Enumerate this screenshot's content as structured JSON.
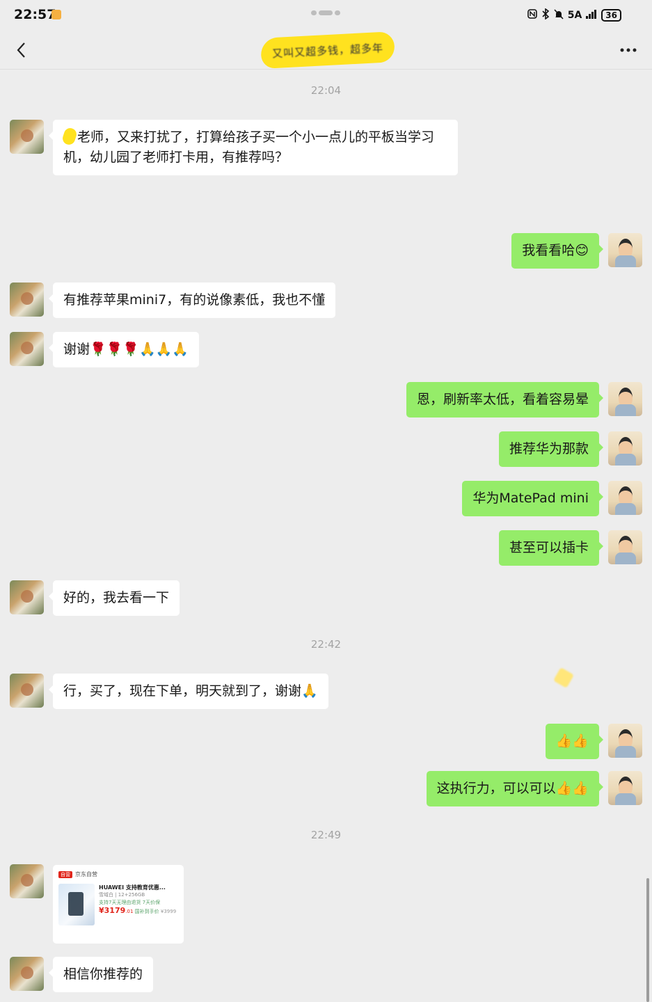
{
  "status_bar": {
    "time": "22:57",
    "network": "5A",
    "battery": "36"
  },
  "nav": {
    "title_redacted": "又叫又超多钱，超多年"
  },
  "timestamps": [
    "22:04",
    "22:42",
    "22:49"
  ],
  "messages": [
    {
      "side": "left",
      "text": "老师，又来打扰了，打算给孩子买一个小一点儿的平板当学习机，幼儿园了老师打卡用，有推荐吗？"
    },
    {
      "side": "right",
      "text": "我看看哈😊"
    },
    {
      "side": "left",
      "text": "有推荐苹果mini7，有的说像素低，我也不懂"
    },
    {
      "side": "left",
      "text": "谢谢🌹🌹🌹🙏🙏🙏"
    },
    {
      "side": "right",
      "text": "恩，刷新率太低，看着容易晕"
    },
    {
      "side": "right",
      "text": "推荐华为那款"
    },
    {
      "side": "right",
      "text": "华为MatePad mini"
    },
    {
      "side": "right",
      "text": "甚至可以插卡"
    },
    {
      "side": "left",
      "text": "好的，我去看一下"
    },
    {
      "side": "left",
      "text": "行，买了，现在下单，明天就到了，谢谢🙏"
    },
    {
      "side": "right",
      "text": "👍👍"
    },
    {
      "side": "right",
      "text": "这执行力，可以可以👍👍"
    },
    {
      "side": "left",
      "text": "相信你推荐的"
    }
  ],
  "product_card": {
    "badge": "自营",
    "store": "京东自营",
    "title": "HUAWEI 支持教育优惠...",
    "spec": "雪域白 | 12+256GB",
    "service": "支持7天无理由退货  7天价保",
    "price": "¥3179",
    "price_decimal": ".01",
    "price_note": "国补到手价",
    "original_price": "¥3999"
  },
  "colors": {
    "background": "#ededed",
    "bubble_self": "#95ec69",
    "bubble_other": "#ffffff",
    "redaction": "#ffe21f"
  }
}
